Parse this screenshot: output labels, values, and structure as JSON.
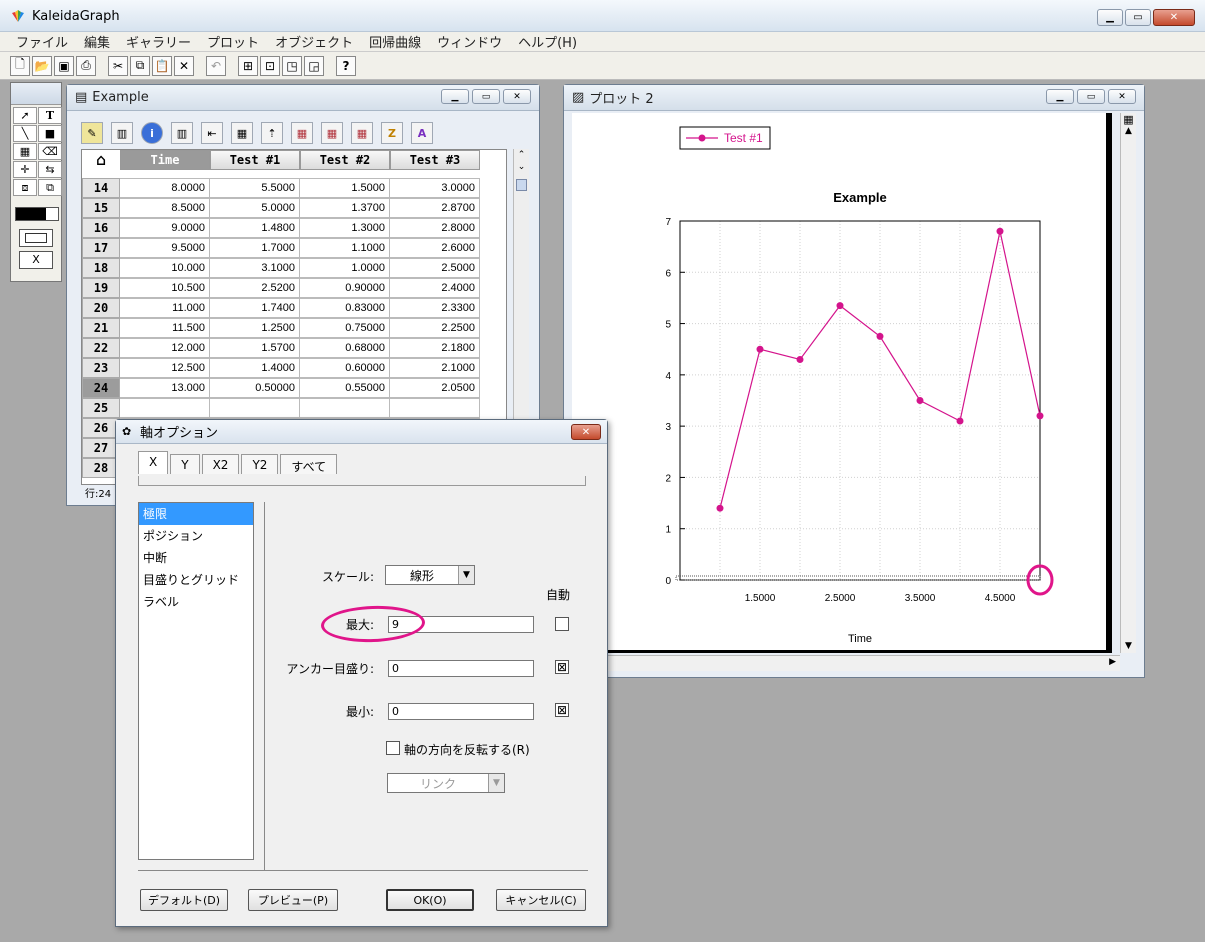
{
  "app": {
    "title": "KaleidaGraph",
    "menu": [
      "ファイル",
      "編集",
      "ギャラリー",
      "プロット",
      "オブジェクト",
      "回帰曲線",
      "ウィンドウ",
      "ヘルプ(H)"
    ],
    "toolbar_icons": [
      "new-file-icon",
      "open-folder-icon",
      "save-icon",
      "print-icon",
      "cut-icon",
      "copy-icon",
      "paste-icon",
      "delete-icon",
      "undo-icon",
      "layout-icon-1",
      "layout-icon-2",
      "layout-icon-3",
      "layout-icon-4",
      "help-icon"
    ],
    "help_glyph": "?"
  },
  "palette": {
    "x_label": "X",
    "text_tool": "T"
  },
  "data_window": {
    "title": "Example",
    "columns": [
      "Time",
      "Test #1",
      "Test #2",
      "Test #3"
    ],
    "rows": [
      {
        "index": "14",
        "cells": [
          "8.0000",
          "5.5000",
          "1.5000",
          "3.0000"
        ]
      },
      {
        "index": "15",
        "cells": [
          "8.5000",
          "5.0000",
          "1.3700",
          "2.8700"
        ]
      },
      {
        "index": "16",
        "cells": [
          "9.0000",
          "1.4800",
          "1.3000",
          "2.8000"
        ]
      },
      {
        "index": "17",
        "cells": [
          "9.5000",
          "1.7000",
          "1.1000",
          "2.6000"
        ]
      },
      {
        "index": "18",
        "cells": [
          "10.000",
          "3.1000",
          "1.0000",
          "2.5000"
        ]
      },
      {
        "index": "19",
        "cells": [
          "10.500",
          "2.5200",
          "0.90000",
          "2.4000"
        ]
      },
      {
        "index": "20",
        "cells": [
          "11.000",
          "1.7400",
          "0.83000",
          "2.3300"
        ]
      },
      {
        "index": "21",
        "cells": [
          "11.500",
          "1.2500",
          "0.75000",
          "2.2500"
        ]
      },
      {
        "index": "22",
        "cells": [
          "12.000",
          "1.5700",
          "0.68000",
          "2.1800"
        ]
      },
      {
        "index": "23",
        "cells": [
          "12.500",
          "1.4000",
          "0.60000",
          "2.1000"
        ]
      },
      {
        "index": "24",
        "cells": [
          "13.000",
          "0.50000",
          "0.55000",
          "2.0500"
        ]
      },
      {
        "index": "25",
        "cells": [
          "",
          "",
          "",
          ""
        ]
      },
      {
        "index": "26",
        "cells": [
          "",
          "",
          "",
          ""
        ]
      },
      {
        "index": "27",
        "cells": [
          "",
          "",
          "",
          ""
        ]
      },
      {
        "index": "28",
        "cells": [
          "",
          "",
          "",
          ""
        ]
      }
    ],
    "selected_row": "24",
    "status": "行:24"
  },
  "plot_window": {
    "title": "プロット 2"
  },
  "chart_data": {
    "type": "line",
    "title": "Example",
    "xlabel": "Time",
    "ylabel": "Test #1",
    "xlim": [
      0.5,
      5.0
    ],
    "ylim": [
      0,
      7
    ],
    "x_ticks": [
      "1.5000",
      "2.5000",
      "3.5000",
      "4.5000"
    ],
    "x_tick_values": [
      1.5,
      2.5,
      3.5,
      4.5
    ],
    "y_ticks": [
      "0",
      "1",
      "2",
      "3",
      "4",
      "5",
      "6",
      "7"
    ],
    "grid": true,
    "legend_position": "top-left",
    "series": [
      {
        "name": "Test #1",
        "color": "#d4148c",
        "x": [
          1.0,
          1.5,
          2.0,
          2.5,
          3.0,
          3.5,
          4.0,
          4.5,
          5.0
        ],
        "y": [
          1.4,
          4.5,
          4.3,
          5.35,
          4.75,
          3.5,
          3.1,
          6.8,
          3.2
        ]
      }
    ]
  },
  "dialog": {
    "title": "軸オプション",
    "tabs": [
      "X",
      "Y",
      "X2",
      "Y2",
      "すべて"
    ],
    "active_tab": "X",
    "categories": [
      "極限",
      "ポジション",
      "中断",
      "目盛りとグリッド",
      "ラベル"
    ],
    "selected_category": "極限",
    "scale_label": "スケール:",
    "scale_value": "線形",
    "auto_header": "自動",
    "max_label": "最大:",
    "max_value": "9",
    "max_auto": false,
    "anchor_label": "アンカー目盛り:",
    "anchor_value": "0",
    "anchor_auto": true,
    "min_label": "最小:",
    "min_value": "0",
    "min_auto": true,
    "reverse_label": "軸の方向を反転する(R)",
    "reverse_checked": false,
    "link_value": "リンク",
    "check_mark": "⊠",
    "buttons": {
      "default": "デフォルト(D)",
      "preview": "プレビュー(P)",
      "ok": "OK(O)",
      "cancel": "キャンセル(C)"
    }
  },
  "colors": {
    "annotation": "#e0158a",
    "series": "#d4148c",
    "selection": "#3399ff"
  }
}
